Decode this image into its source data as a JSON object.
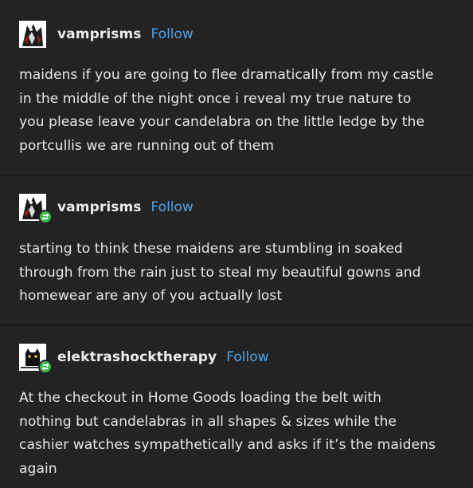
{
  "posts": [
    {
      "username": "vamprisms",
      "follow_label": "Follow",
      "is_reblog": false,
      "avatar_icon": "vampire-avatar-icon",
      "lines": [
        "maidens if you are going to flee dramatically from my castle",
        "in the middle of the night once i reveal my true nature to",
        "you please leave your candelabra on the little ledge by the",
        "portcullis we are running out of them"
      ]
    },
    {
      "username": "vamprisms",
      "follow_label": "Follow",
      "is_reblog": true,
      "avatar_icon": "vampire-avatar-icon",
      "lines": [
        "starting to think these maidens are stumbling in soaked",
        "through from the rain just to steal my beautiful gowns and",
        "homewear are any of you actually lost"
      ]
    },
    {
      "username": "elektrashocktherapy",
      "follow_label": "Follow",
      "is_reblog": true,
      "avatar_icon": "cat-avatar-icon",
      "lines": [
        "At the checkout in Home Goods loading the belt with",
        "nothing but candelabras in all shapes & sizes while the",
        "cashier watches sympathetically and asks if it’s the maidens",
        "again"
      ]
    }
  ],
  "colors": {
    "background": "#232323",
    "text": "#e6e6e6",
    "follow": "#4ea3e6",
    "reblog_badge": "#3fb94f"
  }
}
